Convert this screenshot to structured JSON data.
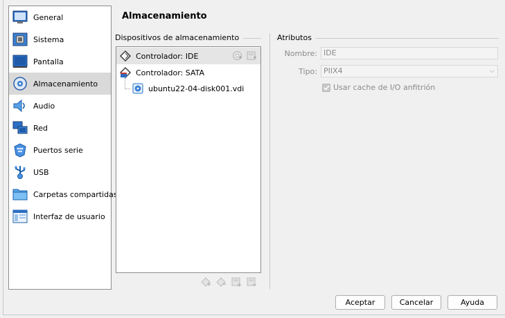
{
  "sidebar": {
    "items": [
      {
        "label": "General",
        "icon": "general-icon"
      },
      {
        "label": "Sistema",
        "icon": "system-icon"
      },
      {
        "label": "Pantalla",
        "icon": "display-icon"
      },
      {
        "label": "Almacenamiento",
        "icon": "storage-icon",
        "selected": true
      },
      {
        "label": "Audio",
        "icon": "audio-icon"
      },
      {
        "label": "Red",
        "icon": "network-icon"
      },
      {
        "label": "Puertos serie",
        "icon": "serial-ports-icon"
      },
      {
        "label": "USB",
        "icon": "usb-icon"
      },
      {
        "label": "Carpetas compartidas",
        "icon": "shared-folders-icon"
      },
      {
        "label": "Interfaz de usuario",
        "icon": "user-interface-icon"
      }
    ]
  },
  "page": {
    "title": "Almacenamiento"
  },
  "storage": {
    "group_label": "Dispositivos de almacenamiento",
    "tree": [
      {
        "label": "Controlador: IDE",
        "icon": "ide-controller-icon",
        "selected": true
      },
      {
        "label": "Controlador: SATA",
        "icon": "sata-controller-icon"
      },
      {
        "label": "ubuntu22-04-disk001.vdi",
        "icon": "hard-disk-icon"
      }
    ]
  },
  "attributes": {
    "group_label": "Atributos",
    "name_label": "Nombre:",
    "name_value": "IDE",
    "type_label": "Tipo:",
    "type_value": "PIIX4",
    "host_cache_label": "Usar cache de I/O anfitrión",
    "host_cache_checked": true
  },
  "buttons": {
    "ok": "Aceptar",
    "cancel": "Cancelar",
    "help": "Ayuda"
  },
  "colors": {
    "selection": "#d9d9d9",
    "accent_blue": "#1f6fc5"
  }
}
